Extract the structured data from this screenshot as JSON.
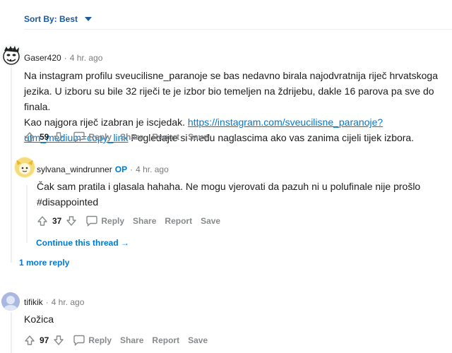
{
  "sort": {
    "label": "Sort By: Best"
  },
  "actions": {
    "reply": "Reply",
    "share": "Share",
    "report": "Report",
    "save": "Save"
  },
  "comments": [
    {
      "author": "Gaser420",
      "time": "4 hr. ago",
      "text_lines": [
        "Na instagram profilu sveucilisne_paranoje se bas nedavno birala najodvratnija riječ hrvatskoga",
        "jezika. U izboru su bile 32 riječi te je izbor bio temeljen na ždrijebu, dakle 16 parova pa sve do finala.",
        "Kao najgora riječ izabran je iscjedak."
      ],
      "link_part1": "https://instagram.com/sveucilisne_paranoje?",
      "link_part2": "utm_medium=copy_link",
      "text_after_link": " Pogledajte si među naglascima ako vas zanima cijeli tijek izbora.",
      "votes": "59"
    },
    {
      "author": "sylvana_windrunner",
      "op_badge": "OP",
      "time": "4 hr. ago",
      "text_lines": [
        "Čak sam pratila i glasala hahaha. Ne mogu vjerovati da pazuh ni u polufinale nije prošlo",
        "#disappointed"
      ],
      "votes": "37"
    },
    {
      "author": "tifikik",
      "time": "4 hr. ago",
      "text_lines": [
        "Kožica"
      ],
      "votes": "97"
    }
  ],
  "continue_thread": "Continue this thread",
  "more_replies": "1 more reply",
  "colors": {
    "link": "#0079d3",
    "meta": "#7c7c7c",
    "action": "#878a8c",
    "divider": "#edeff1"
  }
}
